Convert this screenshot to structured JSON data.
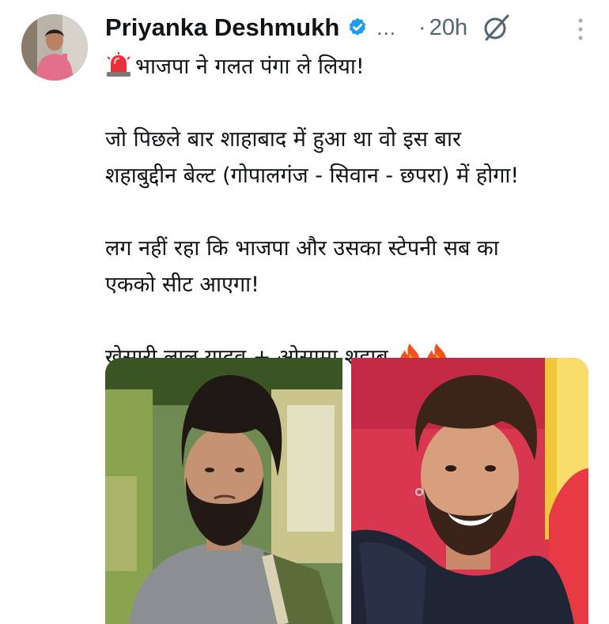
{
  "post": {
    "author": {
      "display_name": "Priyanka Deshmukh",
      "verified": true,
      "handle_truncated": "...",
      "avatar_icon": "user-avatar-photo"
    },
    "time_separator": "·",
    "time": "20h",
    "icons": {
      "verified": "verified-badge-icon",
      "grok": "grok-icon",
      "more": "more-vertical-icon",
      "siren": "siren-emoji",
      "fire": "fire-emoji"
    },
    "text": {
      "line1": "भाजपा ने गलत पंगा ले लिया!",
      "para2_line1": "जो पिछले बार शाहाबाद में हुआ था वो इस बार",
      "para2_line2": "शहाबुद्दीन बेल्ट (गोपालगंज - सिवान - छपरा) में होगा!",
      "para3_line1": "लग नहीं रहा कि भाजपा और उसका स्टेपनी सब का",
      "para3_line2": "एकको सीट आएगा!",
      "para4": "खेसारी लाल यादव + ओसामा शहाब"
    },
    "media": [
      {
        "icon": "photo-bearded-man-grey-shirt"
      },
      {
        "icon": "photo-smiling-man-black-hoodie"
      }
    ],
    "colors": {
      "text": "#0f1419",
      "secondary": "#536471",
      "verified": "#1d9bf0"
    }
  }
}
